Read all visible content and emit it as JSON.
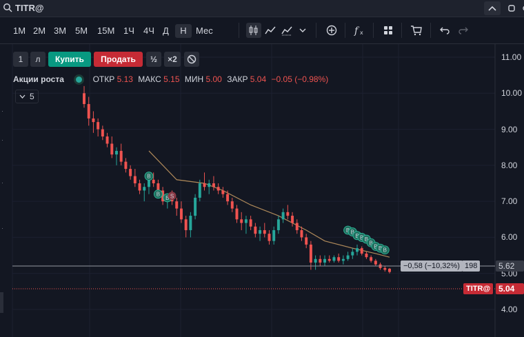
{
  "topbar": {
    "symbol": "TITR@"
  },
  "toolbar": {
    "timeframes": [
      "1М",
      "2М",
      "3М",
      "5М",
      "15М",
      "1Ч",
      "4Ч",
      "Д",
      "Н",
      "Мес"
    ],
    "active_timeframe": "Н"
  },
  "trade": {
    "qty": "1",
    "lot_label": "л",
    "buy_label": "Купить",
    "sell_label": "Продать",
    "half_label": "½",
    "double_label": "×2"
  },
  "legend": {
    "name": "Акции роста",
    "open_label": "ОТКР",
    "open": "5.13",
    "high_label": "МАКС",
    "high": "5.15",
    "low_label": "МИН",
    "low": "5.00",
    "close_label": "ЗАКР",
    "close": "5.04",
    "change": "−0.05 (−0.98%)",
    "indicator_count": "5"
  },
  "markers": {
    "buy": "B",
    "sell": "S"
  },
  "crosshair": {
    "price": "5.62",
    "delta": "−0,58 (−10,32%)",
    "bars": "198"
  },
  "last_price": {
    "symbol": "TITR@",
    "value": "5.04"
  },
  "colors": {
    "up": "#26a69a",
    "down": "#ef5350",
    "bg": "#131722",
    "buy": "#089981",
    "sell": "#f23645",
    "ma": "#b08a5a"
  },
  "chart_data": {
    "type": "candlestick",
    "y_ticks": [
      "11.00",
      "10.00",
      "9.00",
      "8.00",
      "7.00",
      "6.00",
      "5.00",
      "4.00"
    ],
    "ylim": [
      4.0,
      11.0
    ],
    "candles": [
      [
        10.0,
        10.2,
        9.6,
        9.7
      ],
      [
        9.7,
        9.9,
        9.1,
        9.3
      ],
      [
        9.3,
        9.5,
        8.9,
        9.2
      ],
      [
        9.2,
        9.3,
        8.8,
        9.0
      ],
      [
        9.0,
        9.1,
        8.7,
        8.8
      ],
      [
        8.8,
        8.9,
        8.5,
        8.6
      ],
      [
        8.6,
        8.8,
        8.2,
        8.3
      ],
      [
        8.3,
        8.5,
        8.0,
        8.4
      ],
      [
        8.4,
        8.6,
        8.0,
        8.1
      ],
      [
        8.1,
        8.2,
        7.8,
        7.9
      ],
      [
        7.9,
        8.0,
        7.6,
        7.7
      ],
      [
        7.7,
        7.9,
        7.4,
        7.5
      ],
      [
        7.5,
        7.6,
        7.2,
        7.3
      ],
      [
        7.3,
        7.5,
        7.0,
        7.4
      ],
      [
        7.4,
        7.7,
        7.2,
        7.6
      ],
      [
        7.6,
        7.8,
        7.4,
        7.5
      ],
      [
        7.5,
        7.6,
        7.2,
        7.3
      ],
      [
        7.3,
        7.4,
        6.9,
        7.0
      ],
      [
        7.0,
        7.2,
        6.8,
        7.1
      ],
      [
        7.1,
        7.3,
        6.9,
        7.0
      ],
      [
        7.0,
        7.1,
        6.6,
        6.8
      ],
      [
        6.8,
        7.0,
        6.4,
        6.5
      ],
      [
        6.5,
        6.6,
        6.0,
        6.2
      ],
      [
        6.2,
        6.7,
        6.0,
        6.6
      ],
      [
        6.6,
        7.2,
        6.5,
        7.1
      ],
      [
        7.1,
        7.6,
        7.0,
        7.5
      ],
      [
        7.5,
        7.8,
        7.3,
        7.4
      ],
      [
        7.4,
        7.6,
        7.2,
        7.5
      ],
      [
        7.5,
        7.7,
        7.3,
        7.4
      ],
      [
        7.4,
        7.5,
        7.2,
        7.3
      ],
      [
        7.3,
        7.4,
        7.1,
        7.2
      ],
      [
        7.2,
        7.3,
        6.9,
        7.0
      ],
      [
        7.0,
        7.1,
        6.7,
        6.8
      ],
      [
        6.8,
        6.9,
        6.4,
        6.5
      ],
      [
        6.5,
        6.7,
        6.2,
        6.4
      ],
      [
        6.4,
        6.6,
        6.1,
        6.5
      ],
      [
        6.5,
        6.6,
        6.2,
        6.3
      ],
      [
        6.3,
        6.4,
        6.0,
        6.1
      ],
      [
        6.1,
        6.3,
        5.9,
        6.2
      ],
      [
        6.2,
        6.4,
        6.0,
        6.1
      ],
      [
        6.1,
        6.2,
        5.8,
        5.9
      ],
      [
        5.9,
        6.3,
        5.8,
        6.2
      ],
      [
        6.2,
        6.6,
        6.1,
        6.5
      ],
      [
        6.5,
        6.8,
        6.4,
        6.7
      ],
      [
        6.7,
        6.9,
        6.5,
        6.6
      ],
      [
        6.6,
        6.7,
        6.3,
        6.4
      ],
      [
        6.4,
        6.5,
        6.1,
        6.2
      ],
      [
        6.2,
        6.3,
        5.9,
        6.0
      ],
      [
        6.0,
        6.1,
        5.7,
        5.8
      ],
      [
        5.8,
        5.9,
        5.1,
        5.3
      ],
      [
        5.3,
        5.5,
        5.1,
        5.4
      ],
      [
        5.4,
        5.5,
        5.2,
        5.3
      ],
      [
        5.3,
        5.5,
        5.2,
        5.4
      ],
      [
        5.4,
        5.5,
        5.3,
        5.35
      ],
      [
        5.35,
        5.5,
        5.3,
        5.45
      ],
      [
        5.45,
        5.55,
        5.3,
        5.35
      ],
      [
        5.35,
        5.5,
        5.25,
        5.4
      ],
      [
        5.4,
        5.6,
        5.35,
        5.5
      ],
      [
        5.5,
        5.7,
        5.4,
        5.6
      ],
      [
        5.6,
        5.8,
        5.5,
        5.7
      ],
      [
        5.7,
        5.75,
        5.5,
        5.55
      ],
      [
        5.55,
        5.6,
        5.4,
        5.45
      ],
      [
        5.45,
        5.5,
        5.3,
        5.35
      ],
      [
        5.35,
        5.4,
        5.2,
        5.25
      ],
      [
        5.25,
        5.3,
        5.1,
        5.15
      ],
      [
        5.15,
        5.2,
        5.05,
        5.1
      ],
      [
        5.13,
        5.15,
        5.0,
        5.04
      ]
    ],
    "moving_average": [
      [
        14,
        8.4
      ],
      [
        20,
        7.6
      ],
      [
        26,
        7.5
      ],
      [
        30,
        7.3
      ],
      [
        36,
        6.9
      ],
      [
        42,
        6.6
      ],
      [
        48,
        6.2
      ],
      [
        52,
        5.9
      ],
      [
        58,
        5.7
      ],
      [
        63,
        5.55
      ],
      [
        66,
        5.45
      ]
    ]
  }
}
